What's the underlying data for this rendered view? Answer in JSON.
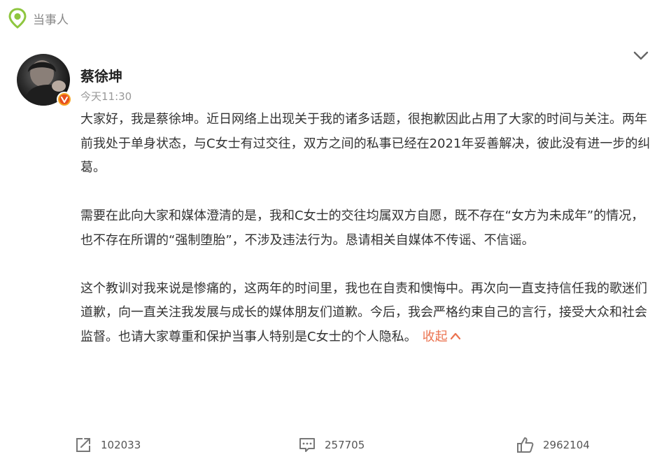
{
  "topic": {
    "label": "当事人",
    "icon": "topic-location-icon",
    "color": "#8ec63f"
  },
  "post": {
    "author": "蔡徐坤",
    "time": "今天11:30",
    "verified_icon": "verified-badge-icon",
    "paragraphs": [
      "大家好，我是蔡徐坤。近日网络上出现关于我的诸多话题，很抱歉因此占用了大家的时间与关注。两年前我处于单身状态，与C女士有过交往，双方之间的私事已经在2021年妥善解决，彼此没有进一步的纠葛。",
      "需要在此向大家和媒体澄清的是，我和C女士的交往均属双方自愿，既不存在“女方为未成年”的情况，也不存在所谓的“强制堕胎”，不涉及违法行为。恳请相关自媒体不传谣、不信谣。",
      "这个教训对我来说是惨痛的，这两年的时间里，我也在自责和懊悔中。再次向一直支持信任我的歌迷们道歉，向一直关注我发展与成长的媒体朋友们道歉。今后，我会严格约束自己的言行，接受大众和社会监督。也请大家尊重和保护当事人特别是C女士的个人隐私。"
    ],
    "collapse_label": "收起",
    "accent_color": "#eb7350"
  },
  "actions": {
    "share_count": "102033",
    "comment_count": "257705",
    "like_count": "2962104"
  }
}
